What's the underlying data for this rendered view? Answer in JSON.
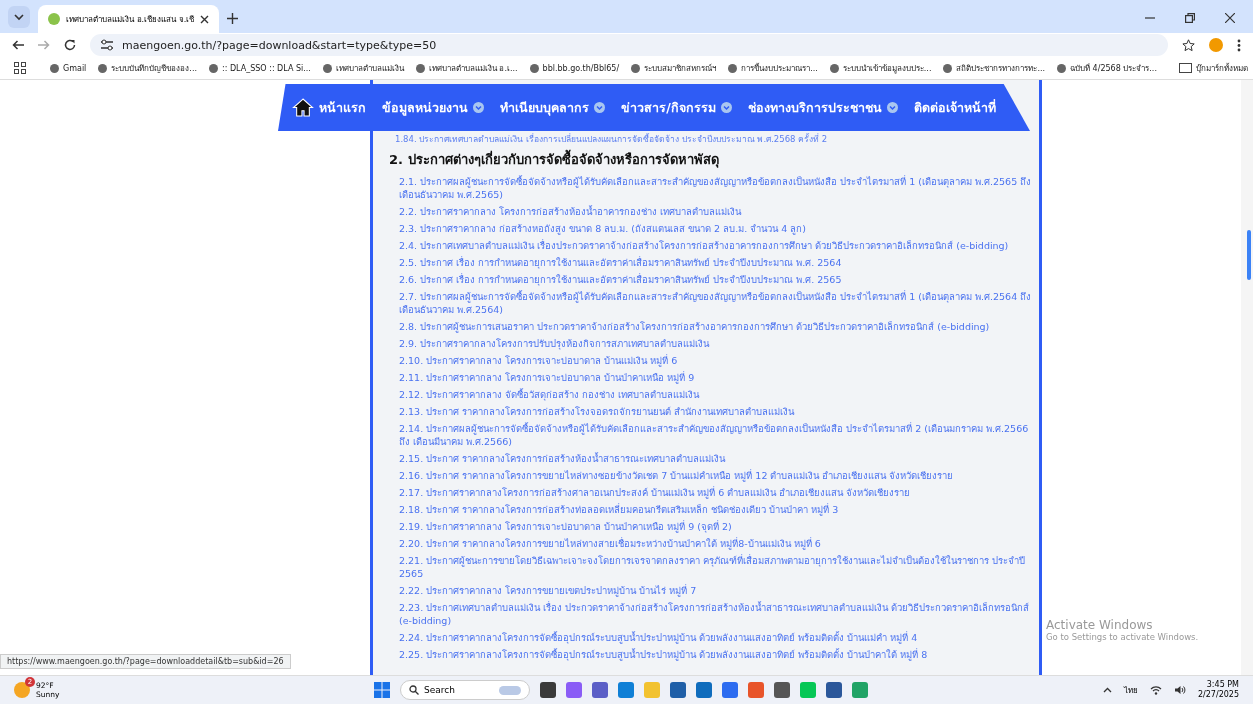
{
  "browser": {
    "tabs": [
      {
        "title": "เทศบาลตำบลแม่เงิน อ.เชียงแสน จ.เชี",
        "selected": true
      }
    ],
    "url": "maengoen.go.th/?page=download&start=type&type=50",
    "bookmarks": [
      "Gmail",
      "ระบบบันทึกบัญชีขององ...",
      ":: DLA_SSO :: DLA Si...",
      "เทศบาลตำบลแม่เงิน",
      "เทศบาลตำบลแม่เงิน อ.เ...",
      "bbl.bb.go.th/Bbl65/",
      "ระบบสมาชิกสหกรณ์ฯ",
      "การขึ้นงบประมาณรา...",
      "ระบบนำเข้าข้อมูลงบประ...",
      "สถิติประชากรทางการทะ...",
      "ฉบับที่ 4/2568 ประจำร..."
    ],
    "all_bookmarks": "บุ๊กมาร์กทั้งหมด"
  },
  "nav": {
    "items": [
      {
        "label": "หน้าแรก",
        "kind": "home",
        "dropdown": false
      },
      {
        "label": "ข้อมูลหน่วยงาน",
        "kind": "menu",
        "dropdown": true
      },
      {
        "label": "ทำเนียบบุคลากร",
        "kind": "menu",
        "dropdown": true
      },
      {
        "label": "ข่าวสาร/กิจกรรม",
        "kind": "menu",
        "dropdown": true
      },
      {
        "label": "ช่องทางบริการประชาชน",
        "kind": "menu",
        "dropdown": true
      },
      {
        "label": "ติดต่อเจ้าหน้าที่",
        "kind": "menu",
        "dropdown": false
      }
    ]
  },
  "content": {
    "previous_item": "1.84. ประกาศเทศบาลตำบลแม่เงิน เรื่องการเปลี่ยนแปลงแผนการจัดซื้อจัดจ้าง ประจำปีงบประมาณ พ.ศ.2568 ครั้งที่ 2",
    "section_title": "2. ประกาศต่างๆเกี่ยวกับการจัดซื้อจัดจ้างหรือการจัดหาพัสดุ",
    "items": [
      "2.1. ประกาศผลผู้ชนะการจัดซื้อจัดจ้างหรือผู้ได้รับคัดเลือกและสาระสำคัญของสัญญาหรือข้อตกลงเป็นหนังสือ ประจำไตรมาสที่ 1 (เดือนตุลาคม พ.ศ.2565 ถึง เดือนธันวาคม พ.ศ.2565)",
      "2.2. ประกาศราคากลาง โครงการก่อสร้างห้องน้ำอาคารกองช่าง เทศบาลตำบลแม่เงิน",
      "2.3. ประกาศราคากลาง ก่อสร้างหอถังสูง ขนาด 8 ลบ.ม. (ถังสแตนเลส ขนาด 2 ลบ.ม. จำนวน 4 ลูก)",
      "2.4. ประกาศเทศบาลตำบลแม่เงิน เรื่องประกวดราคาจ้างก่อสร้างโครงการก่อสร้างอาคารกองการศึกษา ด้วยวิธีประกวดราคาอิเล็กทรอนิกส์ (e-bidding)",
      "2.5. ประกาศ เรื่อง การกำหนดอายุการใช้งานและอัตราค่าเสื่อมราคาสินทรัพย์ ประจำปีงบประมาณ พ.ศ. 2564",
      "2.6. ประกาศ เรื่อง การกำหนดอายุการใช้งานและอัตราค่าเสื่อมราคาสินทรัพย์ ประจำปีงบประมาณ พ.ศ. 2565",
      "2.7. ประกาศผลผู้ชนะการจัดซื้อจัดจ้างหรือผู้ได้รับคัดเลือกและสาระสำคัญของสัญญาหรือข้อตกลงเป็นหนังสือ ประจำไตรมาสที่ 1 (เดือนตุลาคม พ.ศ.2564 ถึง เดือนธันวาคม พ.ศ.2564)",
      "2.8. ประกาศผู้ชนะการเสนอราคา ประกวดราคาจ้างก่อสร้างโครงการก่อสร้างอาคารกองการศึกษา ด้วยวิธีประกวดราคาอิเล็กทรอนิกส์ (e-bidding)",
      "2.9. ประกาศราคากลางโครงการปรับปรุงห้องกิจการสภาเทศบาลตำบลแม่เงิน",
      "2.10. ประกาศราคากลาง โครงการเจาะบ่อบาดาล บ้านแม่เงิน หมู่ที่ 6",
      "2.11. ประกาศราคากลาง โครงการเจาะบ่อบาดาล บ้านป่าคาเหนือ หมู่ที่ 9",
      "2.12. ประกาศราคากลาง จัดซื้อวัสดุก่อสร้าง กองช่าง เทศบาลตำบลแม่เงิน",
      "2.13. ประกาศ ราคากลางโครงการก่อสร้างโรงจอดรถจักรยานยนต์ สำนักงานเทศบาลตำบลแม่เงิน",
      "2.14. ประกาศผลผู้ชนะการจัดซื้อจัดจ้างหรือผู้ได้รับคัดเลือกและสาระสำคัญของสัญญาหรือข้อตกลงเป็นหนังสือ ประจำไตรมาสที่ 2 (เดือนมกราคม พ.ศ.2566 ถึง เดือนมีนาคม พ.ศ.2566)",
      "2.15. ประกาศ ราคากลางโครงการก่อสร้างห้องน้ำสาธารณะเทศบาลตำบลแม่เงิน",
      "2.16. ประกาศ ราคากลางโครงการขยายไหล่ทางซอยข้างวัดเชต 7 บ้านแม่คำเหนือ หมู่ที่ 12 ตำบลแม่เงิน อำเภอเชียงแสน จังหวัดเชียงราย",
      "2.17. ประกาศราคากลางโครงการก่อสร้างศาลาอเนกประสงค์ บ้านแม่เงิน หมู่ที่ 6 ตำบลแม่เงิน อำเภอเชียงแสน จังหวัดเชียงราย",
      "2.18. ประกาศ ราคากลางโครงการก่อสร้างท่อลอดเหลี่ยมคอนกรีตเสริมเหล็ก ชนิดช่องเดียว บ้านป่าคา หมู่ที่ 3",
      "2.19. ประกาศราคากลาง โครงการเจาะบ่อบาดาล บ้านป่าคาเหนือ หมู่ที่ 9 (จุดที่ 2)",
      "2.20. ประกาศ ราคากลางโครงการขยายไหล่ทางสายเชื่อมระหว่างบ้านป่าคาใต้ หมู่ที่8-บ้านแม่เงิน หมู่ที่ 6",
      "2.21. ประกาศผู้ชนะการขายโดยวิธีเฉพาะเจาะจงโดยการเจรจาตกลงราคา ครุภัณฑ์ที่เสื่อมสภาพตามอายุการใช้งานและไม่จำเป็นต้องใช้ในราชการ ประจำปี 2565",
      "2.22. ประกาศราคากลาง โครงการขยายเขตประปาหมู่บ้าน บ้านไร่ หมู่ที่ 7",
      "2.23. ประกาศเทศบาลตำบลแม่เงิน เรื่อง ประกวดราคาจ้างก่อสร้างโครงการก่อสร้างห้องน้ำสาธารณะเทศบาลตำบลแม่เงิน ด้วยวิธีประกวดราคาอิเล็กทรอนิกส์ (e-bidding)",
      "2.24. ประกาศราคากลางโครงการจัดซื้ออุปกรณ์ระบบสูบน้ำประปาหมู่บ้าน ด้วยพลังงานแสงอาทิตย์ พร้อมติดตั้ง บ้านแม่คำ หมู่ที่ 4",
      "2.25. ประกาศราคากลางโครงการจัดซื้ออุปกรณ์ระบบสูบน้ำประปาหมู่บ้าน ด้วยพลังงานแสงอาทิตย์ พร้อมติดตั้ง บ้านป่าคาใต้ หมู่ที่ 8"
    ]
  },
  "status_url": "https://www.maengoen.go.th/?page=downloaddetail&tb=sub&id=26",
  "watermark": {
    "title": "Activate Windows",
    "subtitle": "Go to Settings to activate Windows."
  },
  "taskbar": {
    "weather": {
      "temperature": "92°F",
      "condition": "Sunny",
      "badge": "2"
    },
    "search_placeholder": "Search",
    "language": "ไทย",
    "time": "3:45 PM",
    "date": "2/27/2025"
  }
}
